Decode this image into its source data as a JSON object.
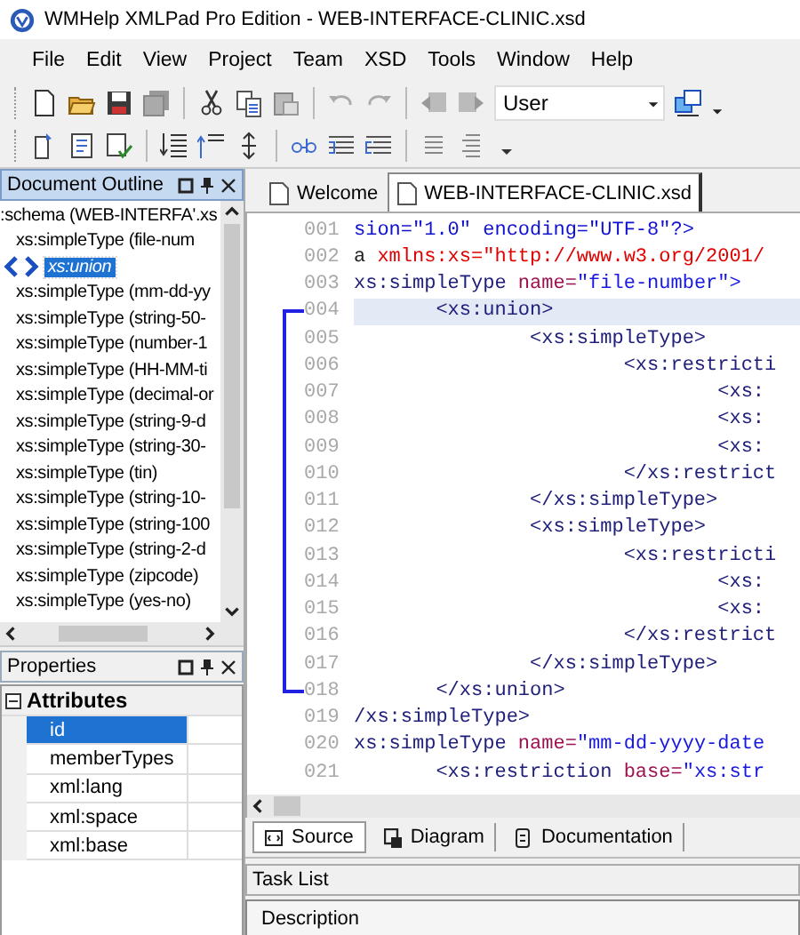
{
  "window": {
    "title": "WMHelp XMLPad Pro Edition - WEB-INTERFACE-CLINIC.xsd"
  },
  "menu": [
    "File",
    "Edit",
    "View",
    "Project",
    "Team",
    "XSD",
    "Tools",
    "Window",
    "Help"
  ],
  "toolbar": {
    "combo_value": "User"
  },
  "outline": {
    "title": "Document Outline",
    "active": true,
    "tree": [
      {
        "label": ":schema (WEB-INTERFA'.xs",
        "selected": false,
        "children": [
          {
            "label": "xs:simpleType (file-num",
            "selected": false,
            "children": [
              {
                "label": "xs:union",
                "selected": true
              }
            ]
          },
          {
            "label": "xs:simpleType (mm-dd-yy",
            "selected": false
          },
          {
            "label": "xs:simpleType (string-50-",
            "selected": false
          },
          {
            "label": "xs:simpleType (number-1",
            "selected": false
          },
          {
            "label": "xs:simpleType (HH-MM-ti",
            "selected": false
          },
          {
            "label": "xs:simpleType (decimal-or",
            "selected": false
          },
          {
            "label": "xs:simpleType (string-9-d",
            "selected": false
          },
          {
            "label": "xs:simpleType (string-30-",
            "selected": false
          },
          {
            "label": "xs:simpleType (tin)",
            "selected": false
          },
          {
            "label": "xs:simpleType (string-10-",
            "selected": false
          },
          {
            "label": "xs:simpleType (string-100",
            "selected": false
          },
          {
            "label": "xs:simpleType (string-2-d",
            "selected": false
          },
          {
            "label": "xs:simpleType (zipcode)",
            "selected": false
          },
          {
            "label": "xs:simpleType (yes-no)",
            "selected": false
          }
        ]
      }
    ]
  },
  "properties": {
    "title": "Properties",
    "active": false,
    "group": "Attributes",
    "expanded": true,
    "rows": [
      {
        "name": "id",
        "selected": true
      },
      {
        "name": "memberTypes",
        "selected": false
      },
      {
        "name": "xml:lang",
        "selected": false
      },
      {
        "name": "xml:space",
        "selected": false
      },
      {
        "name": "xml:base",
        "selected": false
      }
    ]
  },
  "editor": {
    "tabs": [
      {
        "label": "Welcome",
        "selected": false
      },
      {
        "label": "WEB-INTERFACE-CLINIC.xsd",
        "selected": true
      }
    ],
    "lines": [
      {
        "number": "001",
        "current": false,
        "segments": [
          {
            "kind": "pi",
            "text": "sion=\"1.0\" encoding=\"UTF-8\"?>"
          }
        ]
      },
      {
        "number": "002",
        "current": false,
        "segments": [
          {
            "kind": "plain",
            "text": "a "
          },
          {
            "kind": "ns",
            "text": "xmlns:xs=\"http://www.w3.org/2001/"
          }
        ]
      },
      {
        "number": "003",
        "current": false,
        "segments": [
          {
            "kind": "tag",
            "text": "xs:simpleType"
          },
          {
            "kind": "attr",
            "text": " name="
          },
          {
            "kind": "value",
            "text": "\"file-number\">"
          }
        ]
      },
      {
        "number": "004",
        "current": true,
        "kind": "fold_start",
        "segments": [
          {
            "kind": "tag",
            "text": "       <xs:union>"
          }
        ]
      },
      {
        "number": "005",
        "current": false,
        "kind": "fold_inner",
        "segments": [
          {
            "kind": "tag",
            "text": "               <xs:simpleType>"
          }
        ]
      },
      {
        "number": "006",
        "current": false,
        "kind": "fold_inner",
        "segments": [
          {
            "kind": "tag",
            "text": "                       <xs:restricti"
          }
        ]
      },
      {
        "number": "007",
        "current": false,
        "kind": "fold_inner",
        "segments": [
          {
            "kind": "tag",
            "text": "                               <xs:"
          }
        ]
      },
      {
        "number": "008",
        "current": false,
        "kind": "fold_inner",
        "segments": [
          {
            "kind": "tag",
            "text": "                               <xs:"
          }
        ]
      },
      {
        "number": "009",
        "current": false,
        "kind": "fold_inner",
        "segments": [
          {
            "kind": "tag",
            "text": "                               <xs:"
          }
        ]
      },
      {
        "number": "010",
        "current": false,
        "kind": "fold_inner",
        "segments": [
          {
            "kind": "tag",
            "text": "                       </xs:restrict"
          }
        ]
      },
      {
        "number": "011",
        "current": false,
        "kind": "fold_inner",
        "segments": [
          {
            "kind": "tag",
            "text": "               </xs:simpleType>"
          }
        ]
      },
      {
        "number": "012",
        "current": false,
        "kind": "fold_inner",
        "segments": [
          {
            "kind": "tag",
            "text": "               <xs:simpleType>"
          }
        ]
      },
      {
        "number": "013",
        "current": false,
        "kind": "fold_inner",
        "segments": [
          {
            "kind": "tag",
            "text": "                       <xs:restricti"
          }
        ]
      },
      {
        "number": "014",
        "current": false,
        "kind": "fold_inner",
        "segments": [
          {
            "kind": "tag",
            "text": "                               <xs:"
          }
        ]
      },
      {
        "number": "015",
        "current": false,
        "kind": "fold_inner",
        "segments": [
          {
            "kind": "tag",
            "text": "                               <xs:"
          }
        ]
      },
      {
        "number": "016",
        "current": false,
        "kind": "fold_inner",
        "segments": [
          {
            "kind": "tag",
            "text": "                       </xs:restrict"
          }
        ]
      },
      {
        "number": "017",
        "current": false,
        "kind": "fold_inner",
        "segments": [
          {
            "kind": "tag",
            "text": "               </xs:simpleType>"
          }
        ]
      },
      {
        "number": "018",
        "current": false,
        "kind": "fold_end",
        "segments": [
          {
            "kind": "tag",
            "text": "       </xs:union>"
          }
        ]
      },
      {
        "number": "019",
        "current": false,
        "segments": [
          {
            "kind": "tag",
            "text": "/xs:simpleType>"
          }
        ]
      },
      {
        "number": "020",
        "current": false,
        "segments": [
          {
            "kind": "tag",
            "text": "xs:simpleType"
          },
          {
            "kind": "attr",
            "text": " name="
          },
          {
            "kind": "value",
            "text": "\"mm-dd-yyyy-date"
          }
        ]
      },
      {
        "number": "021",
        "current": false,
        "segments": [
          {
            "kind": "tag",
            "text": "       <xs:restriction"
          },
          {
            "kind": "attr",
            "text": " base="
          },
          {
            "kind": "value",
            "text": "\"xs:str"
          }
        ]
      }
    ],
    "view_tabs": [
      {
        "label": "Source",
        "selected": true
      },
      {
        "label": "Diagram",
        "selected": false
      },
      {
        "label": "Documentation",
        "selected": false
      }
    ]
  },
  "task_list": {
    "title": "Task List",
    "columns": [
      "Description"
    ]
  }
}
